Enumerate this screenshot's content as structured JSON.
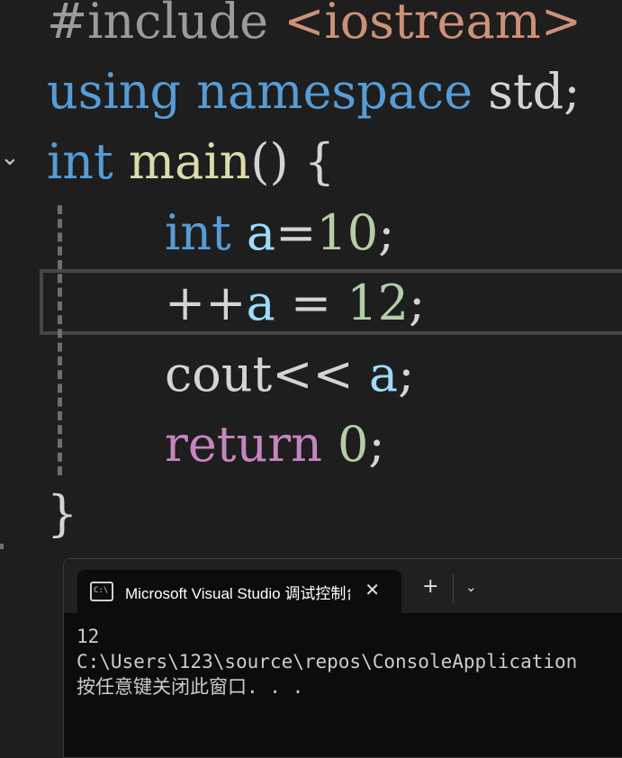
{
  "editor": {
    "lines": [
      {
        "include_kw": "#include ",
        "include_header": "<iostream>"
      },
      {
        "using": "using",
        "namespace": "namespace",
        "std": "std",
        "semi": ";"
      },
      {
        "int": "int",
        "main": "main",
        "parens": "()",
        "brace": "{"
      },
      {
        "int": "int",
        "var": "a",
        "eq": "=",
        "num": "10",
        "semi": ";"
      },
      {
        "op": "++",
        "var": "a",
        "eq": " = ",
        "num": "12",
        "semi": ";"
      },
      {
        "cout": "cout",
        "op": "<<",
        "var": "a",
        "semi": ";"
      },
      {
        "ret": "return",
        "num": "0",
        "semi": ";"
      },
      {
        "brace": "}"
      }
    ]
  },
  "console": {
    "tab_title": "Microsoft Visual Studio 调试控制台",
    "close_glyph": "✕",
    "new_tab_glyph": "+",
    "dropdown_glyph": "⌄",
    "output": [
      "12",
      "C:\\Users\\123\\source\\repos\\ConsoleApplication",
      "按任意键关闭此窗口. . ."
    ]
  },
  "icons": {
    "fold": "chevron-down-icon",
    "terminal": "terminal-icon",
    "close": "close-icon",
    "plus": "plus-icon",
    "dropdown": "chevron-down-icon"
  },
  "colors": {
    "keyword": "#569cd6",
    "control": "#c586c0",
    "string": "#ce9178",
    "function": "#dcdcaa",
    "variable": "#9cdcfe",
    "number": "#b5cea8",
    "background": "#1e1e1e"
  }
}
